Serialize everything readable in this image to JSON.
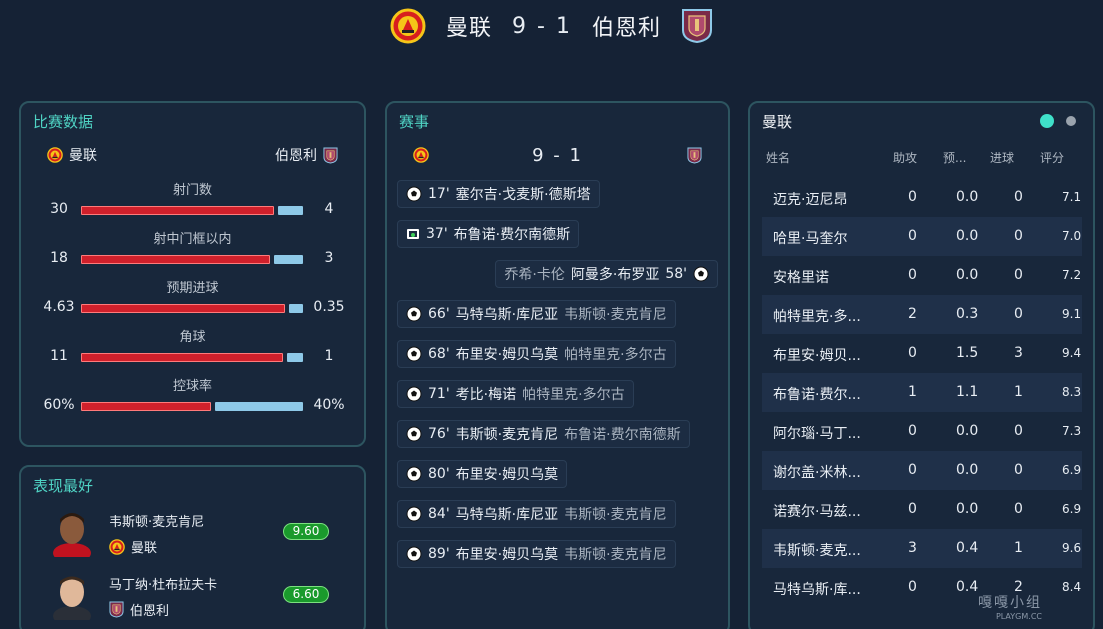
{
  "header": {
    "home": "曼联",
    "score": "9 - 1",
    "away": "伯恩利"
  },
  "stats": {
    "title": "比赛数据",
    "home": "曼联",
    "away": "伯恩利",
    "rows": [
      {
        "label": "射门数",
        "home": "30",
        "away": "4",
        "home_share": 0.88
      },
      {
        "label": "射中门框以内",
        "home": "18",
        "away": "3",
        "home_share": 0.86
      },
      {
        "label": "预期进球",
        "home": "4.63",
        "away": "0.35",
        "home_share": 0.93
      },
      {
        "label": "角球",
        "home": "11",
        "away": "1",
        "home_share": 0.92
      },
      {
        "label": "控球率",
        "home": "60%",
        "away": "40%",
        "home_share": 0.6
      }
    ]
  },
  "best": {
    "title": "表现最好",
    "players": [
      {
        "name": "韦斯顿·麦克肯尼",
        "team": "曼联",
        "rating": "9.60"
      },
      {
        "name": "马丁纳·杜布拉夫卡",
        "team": "伯恩利",
        "rating": "6.60"
      }
    ]
  },
  "events": {
    "title": "赛事",
    "score": "9 - 1",
    "items": [
      {
        "minute": "17'",
        "scorer": "塞尔吉·戈麦斯·德斯塔",
        "assist": "",
        "side": "home",
        "icon": "ball-icon"
      },
      {
        "minute": "37'",
        "scorer": "布鲁诺·费尔南德斯",
        "assist": "",
        "side": "home",
        "icon": "penalty-icon"
      },
      {
        "minute": "58'",
        "scorer": "阿曼多·布罗亚",
        "assist": "乔希·卡伦",
        "side": "away",
        "icon": "ball-icon"
      },
      {
        "minute": "66'",
        "scorer": "马特乌斯·库尼亚",
        "assist": "韦斯顿·麦克肯尼",
        "side": "home",
        "icon": "ball-icon"
      },
      {
        "minute": "68'",
        "scorer": "布里安·姆贝乌莫",
        "assist": "帕特里克·多尔古",
        "side": "home",
        "icon": "ball-icon"
      },
      {
        "minute": "71'",
        "scorer": "考比·梅诺",
        "assist": "帕特里克·多尔古",
        "side": "home",
        "icon": "ball-icon"
      },
      {
        "minute": "76'",
        "scorer": "韦斯顿·麦克肯尼",
        "assist": "布鲁诺·费尔南德斯",
        "side": "home",
        "icon": "ball-icon"
      },
      {
        "minute": "80'",
        "scorer": "布里安·姆贝乌莫",
        "assist": "",
        "side": "home",
        "icon": "ball-icon"
      },
      {
        "minute": "84'",
        "scorer": "马特乌斯·库尼亚",
        "assist": "韦斯顿·麦克肯尼",
        "side": "home",
        "icon": "ball-icon"
      },
      {
        "minute": "89'",
        "scorer": "布里安·姆贝乌莫",
        "assist": "韦斯顿·麦克肯尼",
        "side": "home",
        "icon": "ball-icon"
      }
    ]
  },
  "lineup": {
    "title": "曼联",
    "columns": [
      "姓名",
      "助攻",
      "预...",
      "进球",
      "评分"
    ],
    "rows": [
      {
        "name": "迈克·迈尼昂",
        "assists": "0",
        "xg": "0.0",
        "goals": "0",
        "rating": "7.1"
      },
      {
        "name": "哈里·马奎尔",
        "assists": "0",
        "xg": "0.0",
        "goals": "0",
        "rating": "7.0"
      },
      {
        "name": "安格里诺",
        "assists": "0",
        "xg": "0.0",
        "goals": "0",
        "rating": "7.2"
      },
      {
        "name": "帕特里克·多...",
        "assists": "2",
        "xg": "0.3",
        "goals": "0",
        "rating": "9.1"
      },
      {
        "name": "布里安·姆贝...",
        "assists": "0",
        "xg": "1.5",
        "goals": "3",
        "rating": "9.4"
      },
      {
        "name": "布鲁诺·费尔...",
        "assists": "1",
        "xg": "1.1",
        "goals": "1",
        "rating": "8.3"
      },
      {
        "name": "阿尔瑙·马丁...",
        "assists": "0",
        "xg": "0.0",
        "goals": "0",
        "rating": "7.3"
      },
      {
        "name": "谢尔盖·米林...",
        "assists": "0",
        "xg": "0.0",
        "goals": "0",
        "rating": "6.9"
      },
      {
        "name": "诺赛尔·马兹...",
        "assists": "0",
        "xg": "0.0",
        "goals": "0",
        "rating": "6.9"
      },
      {
        "name": "韦斯顿·麦克...",
        "assists": "3",
        "xg": "0.4",
        "goals": "1",
        "rating": "9.6"
      },
      {
        "name": "马特乌斯·库...",
        "assists": "0",
        "xg": "0.4",
        "goals": "2",
        "rating": "8.4"
      }
    ]
  },
  "watermark": {
    "text": "嘎嘎小组",
    "site": "PLAYGM.CC"
  },
  "colors": {
    "accent": "#4fd3c4",
    "home_bar": "#d0202b",
    "away_bar": "#8ec9e8",
    "rating_green": "#1a9a2c"
  }
}
